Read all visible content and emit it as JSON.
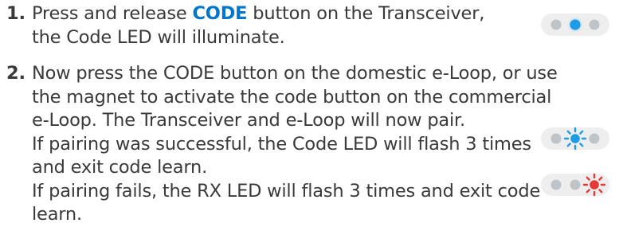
{
  "steps": [
    {
      "number": "1.",
      "line1_before": "Press and release ",
      "line1_highlight": "CODE",
      "line1_after": " button on the Transceiver,",
      "lines": [
        "the Code LED will illuminate."
      ]
    },
    {
      "number": "2.",
      "lines": [
        "Now press the CODE button on the domestic e-Loop, or use",
        "the magnet to activate the code button on the commercial",
        "e-Loop. The Transceiver and e-Loop will now pair.",
        "If pairing was successful, the Code LED will flash 3 times",
        "and exit code learn.",
        "If pairing fails, the RX LED will flash 3 times and exit code",
        "learn."
      ]
    }
  ],
  "led_indicators": [
    {
      "leds": [
        "off",
        "blue",
        "off"
      ]
    },
    {
      "leds": [
        "off",
        "blue-flashing",
        "off"
      ]
    },
    {
      "leds": [
        "off",
        "off",
        "red-flashing"
      ]
    }
  ],
  "colors": {
    "text": "#3a3a3a",
    "highlight": "#0077cc",
    "led_off": "#bfc4c9",
    "led_blue": "#1e9be6",
    "led_red": "#e53935",
    "strip_bg": "#eeeeee"
  }
}
